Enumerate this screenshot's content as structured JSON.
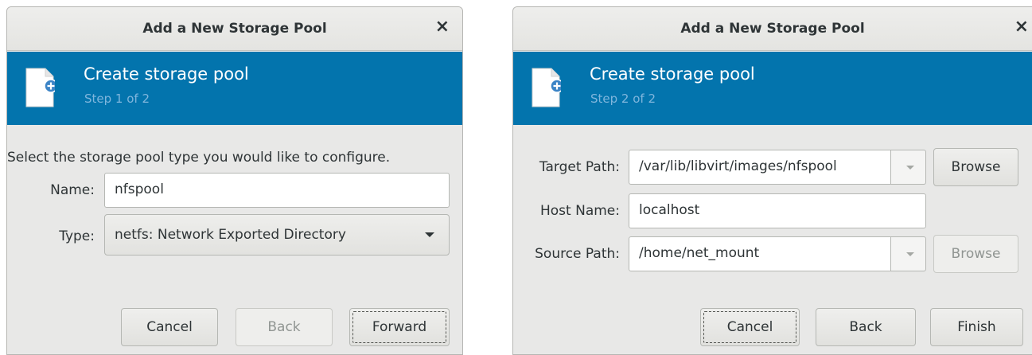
{
  "dialog1": {
    "title": "Add a New Storage Pool",
    "close_label": "×",
    "banner": {
      "heading": "Create storage pool",
      "step": "Step 1 of 2"
    },
    "intro": "Select the storage pool type you would like to configure.",
    "name_label": "Name:",
    "name_value": "nfspool",
    "type_label": "Type:",
    "type_value": "netfs: Network Exported Directory",
    "buttons": {
      "cancel": "Cancel",
      "back": "Back",
      "forward": "Forward"
    }
  },
  "dialog2": {
    "title": "Add a New Storage Pool",
    "close_label": "×",
    "banner": {
      "heading": "Create storage pool",
      "step": "Step 2 of 2"
    },
    "target_path_label": "Target Path:",
    "target_path_value": "/var/lib/libvirt/images/nfspool",
    "browse_label": "Browse",
    "host_name_label": "Host Name:",
    "host_name_value": "localhost",
    "source_path_label": "Source Path:",
    "source_path_value": "/home/net_mount",
    "buttons": {
      "cancel": "Cancel",
      "back": "Back",
      "finish": "Finish"
    }
  },
  "colors": {
    "banner": "#0374ad",
    "banner_subtext": "#7fb6dd",
    "dialog_bg": "#e8e8e7"
  }
}
